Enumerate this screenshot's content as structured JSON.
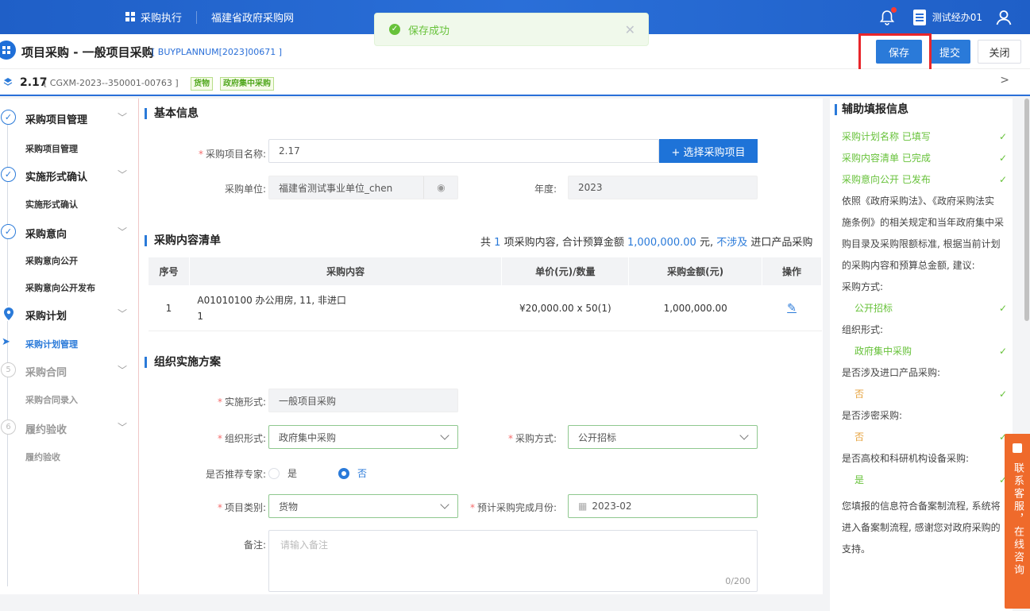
{
  "topbar": {
    "nav": [
      "采购执行",
      "福建省政府采购网"
    ],
    "username": "测试经办01"
  },
  "toast": {
    "message": "保存成功"
  },
  "header": {
    "title": "项目采购 - 一般项目采购",
    "code": "[ BUYPLANNUM[2023]00671 ]",
    "save": "保存",
    "submit": "提交",
    "close": "关闭"
  },
  "subheader": {
    "name": "2.17",
    "code": "[ CGXM-2023--350001-00763 ]",
    "tags": [
      "货物",
      "政府集中采购"
    ]
  },
  "sidebar": {
    "steps": [
      {
        "label": "采购项目管理",
        "sub": "采购项目管理"
      },
      {
        "label": "实施形式确认",
        "sub": "实施形式确认"
      },
      {
        "label": "采购意向",
        "sub1": "采购意向公开",
        "sub2": "采购意向公开发布"
      },
      {
        "label": "采购计划",
        "sub": "采购计划管理"
      },
      {
        "label": "采购合同",
        "num": "5",
        "sub": "采购合同录入"
      },
      {
        "label": "履约验收",
        "num": "6",
        "sub": "履约验收"
      }
    ]
  },
  "basic": {
    "title": "基本信息",
    "name_label": "采购项目名称:",
    "name_value": "2.17",
    "pick_btn": "+ 选择采购项目",
    "unit_label": "采购单位:",
    "unit_value": "福建省测试事业单位_chen",
    "year_label": "年度:",
    "year_value": "2023"
  },
  "contents": {
    "title": "采购内容清单",
    "summary_a": "共",
    "count": "1",
    "summary_b": "项采购内容,  合计预算金额",
    "total": "1,000,000.00",
    "summary_c": "元,",
    "import_flag": "不涉及",
    "summary_d": "进口产品采购",
    "headers": [
      "序号",
      "采购内容",
      "单价(元)/数量",
      "采购金额(元)",
      "操作"
    ],
    "rows": [
      {
        "no": "1",
        "content1": "A01010100 办公用房, 11, 非进口",
        "content2": "1",
        "price": "¥20,000.00 x 50(1)",
        "amount": "1,000,000.00"
      }
    ]
  },
  "org": {
    "title": "组织实施方案",
    "impl_label": "实施形式:",
    "impl_value": "一般项目采购",
    "orgform_label": "组织形式:",
    "orgform_value": "政府集中采购",
    "method_label": "采购方式:",
    "method_value": "公开招标",
    "expert_label": "是否推荐专家:",
    "yes": "是",
    "no": "否",
    "category_label": "项目类别:",
    "category_value": "货物",
    "month_label": "预计采购完成月份:",
    "month_value": "2023-02",
    "note_label": "备注:",
    "note_placeholder": "请输入备注",
    "note_count": "0/200"
  },
  "aux": {
    "title": "辅助填报信息",
    "status": [
      "采购计划名称 已填写",
      "采购内容清单 已完成",
      "采购意向公开 已发布"
    ],
    "desc1": "依照《政府采购法》、《政府采购法实",
    "desc2": "施条例》的相关规定和当年政府集中采",
    "desc3": "购目录及采购限额标准, 根据当前计划",
    "desc4": "的采购内容和预算总金额, 建议:",
    "q_method": "采购方式:",
    "a_method": "公开招标",
    "q_form": "组织形式:",
    "a_form": "政府集中采购",
    "q_import": "是否涉及进口产品采购:",
    "a_import": "否",
    "q_secret": "是否涉密采购:",
    "a_secret": "否",
    "q_univ": "是否高校和科研机构设备采购:",
    "a_univ": "是",
    "end1": "您填报的信息符合备案制流程, 系统将",
    "end2": "进入备案制流程, 感谢您对政府采购的",
    "end3": "支持。"
  },
  "service": {
    "text": "联系客服，在线咨询"
  }
}
